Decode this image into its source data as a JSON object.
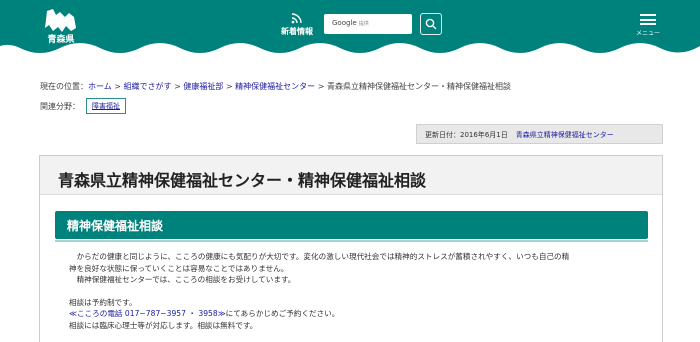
{
  "header": {
    "logo_text": "青森県",
    "news_label": "新着情報",
    "search_label": "Google",
    "search_sub": "提供",
    "menu_label": "メニュー",
    "colors": {
      "teal": "#00827c"
    }
  },
  "breadcrumb": {
    "prefix": "現在の位置：",
    "items": [
      "ホーム",
      "組織でさがす",
      "健康福祉部",
      "精神保健福祉センター"
    ],
    "current": "青森県立精神保健福祉センター・精神保健福祉相談"
  },
  "related": {
    "label": "関連分野：",
    "tag": "障害福祉"
  },
  "updated": {
    "label": "更新日付：2016年6月1日",
    "org": "青森県立精神保健福祉センター"
  },
  "main": {
    "title": "青森県立精神保健福祉センター・精神保健福祉相談",
    "section_title": "精神保健福祉相談",
    "para1_line1": "からだの健康と同じように、こころの健康にも気配りが大切です。変化の激しい現代社会では精神的ストレスが蓄積されやすく、いつも自己の精",
    "para1_line2": "神を良好な状態に保っていくことは容易なことではありません。",
    "para1_line3": "精神保健福祉センターでは、こころの相談をお受けしています。",
    "para2_line1": "相談は予約制です。",
    "tel_text": "≪こころの電話 017−787−3957 ・ 3958≫",
    "para2_line2_rest": "にてあらかじめご予約ください。",
    "para2_line3": "相談には臨床心理士等が対応します。相談は無料です。"
  }
}
